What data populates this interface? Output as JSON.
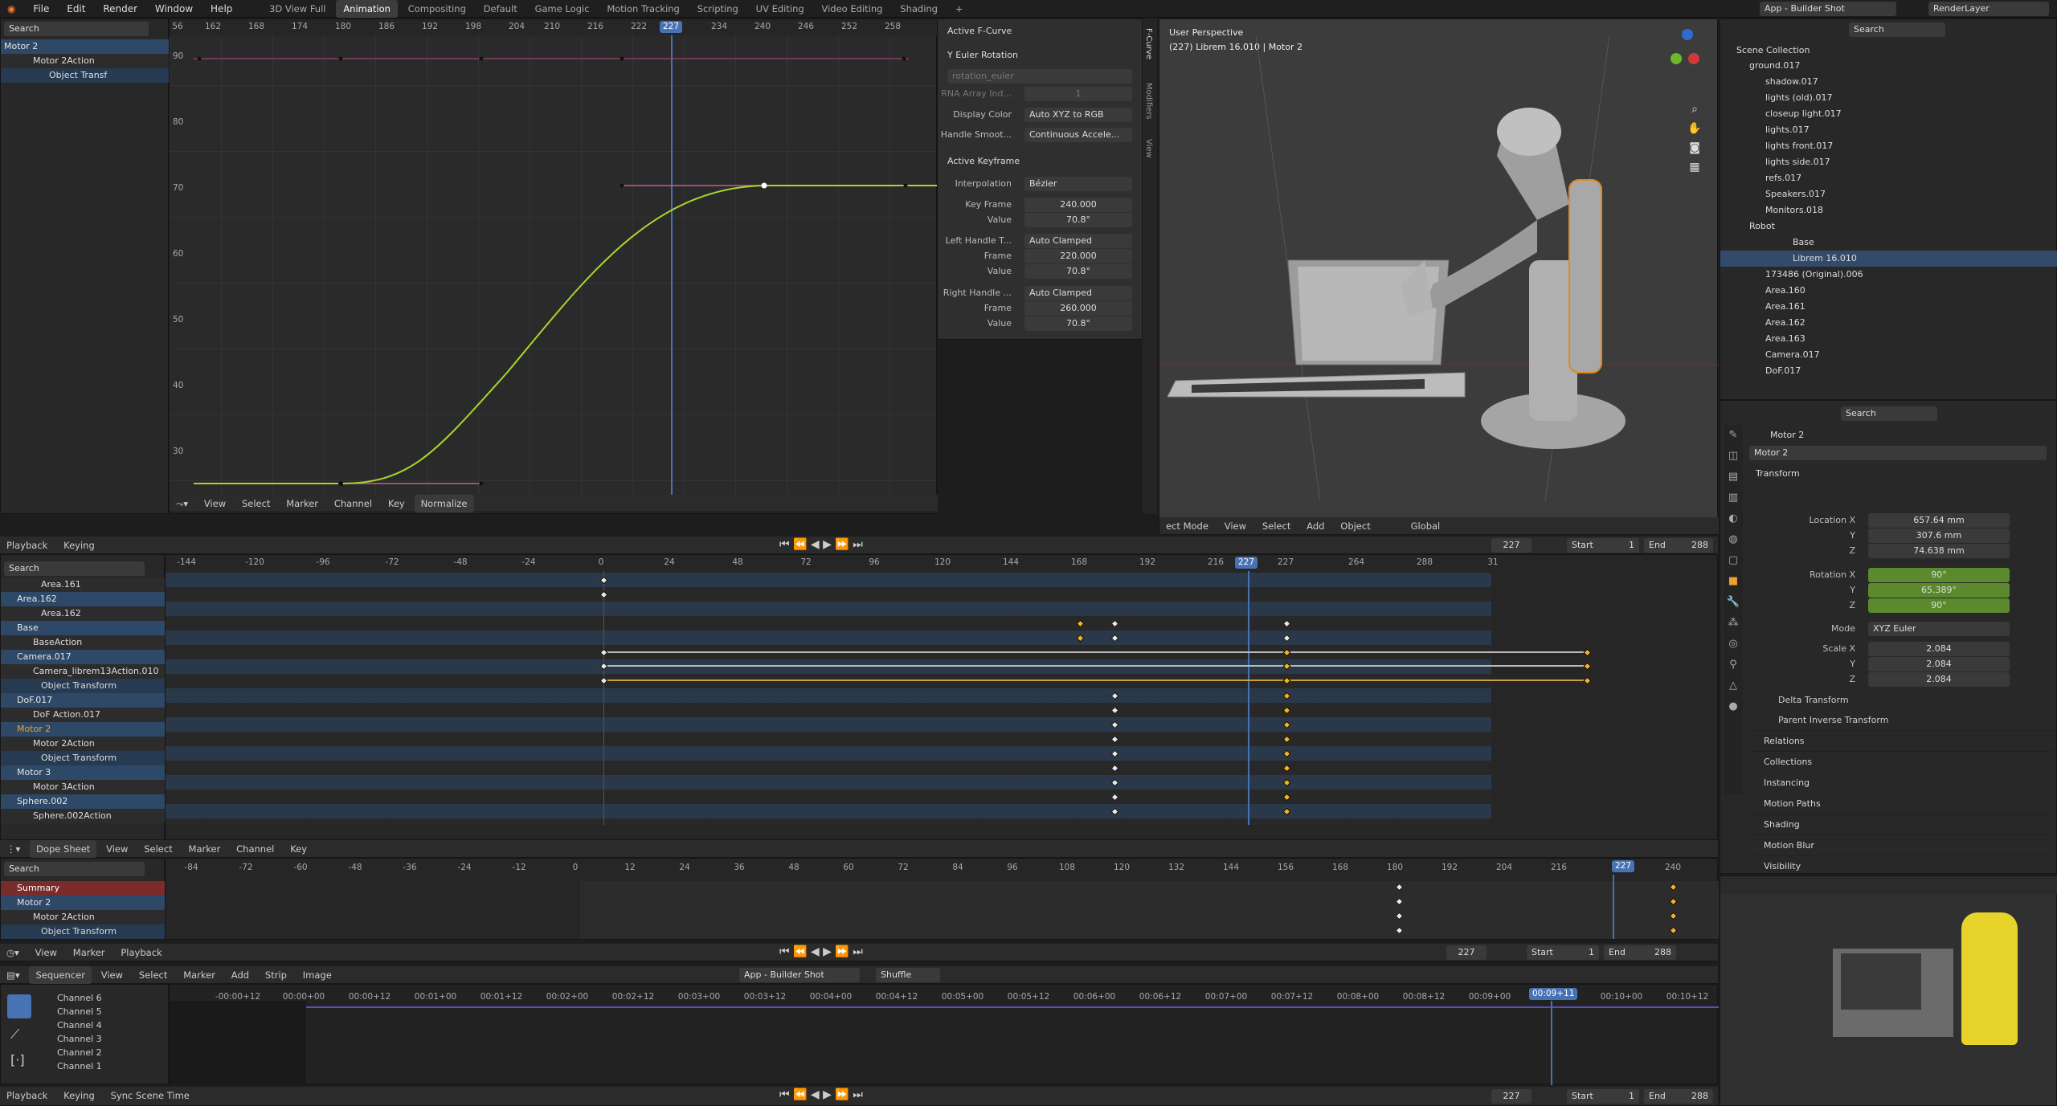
{
  "menu": {
    "items": [
      "File",
      "Edit",
      "Render",
      "Window",
      "Help"
    ],
    "workspaces": [
      "3D View Full",
      "Animation",
      "Compositing",
      "Default",
      "Game Logic",
      "Motion Tracking",
      "Scripting",
      "UV Editing",
      "Video Editing",
      "Shading"
    ],
    "scene": "App - Builder Shot",
    "render_layer": "RenderLayer"
  },
  "graph": {
    "search_placeholder": "Search",
    "channels": [
      "Motor 2",
      "Motor 2Action",
      "Object Transf"
    ],
    "ticks": [
      "56",
      "162",
      "168",
      "174",
      "180",
      "186",
      "192",
      "198",
      "204",
      "210",
      "216",
      "222",
      "227",
      "234",
      "240",
      "246",
      "252",
      "258",
      "264"
    ],
    "yticks": [
      "90",
      "80",
      "70",
      "60",
      "50",
      "40",
      "30"
    ],
    "current_frame": "227",
    "header": [
      "View",
      "Select",
      "Marker",
      "Channel",
      "Key",
      "Normalize"
    ]
  },
  "fcurve_panel": {
    "tabs": [
      "F-Curve",
      "Modifiers",
      "View"
    ],
    "active_fcurve_title": "Active F-Curve",
    "channel": "Y Euler Rotation",
    "data_path": "rotation_euler",
    "rna_label": "RNA Array Ind...",
    "rna_value": "1",
    "display_color_label": "Display Color",
    "display_color": "Auto XYZ to RGB",
    "handle_smooth_label": "Handle Smoot...",
    "handle_smooth": "Continuous Accele...",
    "active_keyframe_title": "Active Keyframe",
    "interp_label": "Interpolation",
    "interp": "Bézier",
    "kf_frame_label": "Key Frame",
    "kf_frame": "240.000",
    "value_label": "Value",
    "kf_value": "70.8°",
    "lh_label": "Left Handle T...",
    "lh_type": "Auto Clamped",
    "frame_label": "Frame",
    "lh_frame": "220.000",
    "lh_value": "70.8°",
    "rh_label": "Right Handle ...",
    "rh_type": "Auto Clamped",
    "rh_frame": "260.000",
    "rh_value": "70.8°"
  },
  "viewport": {
    "title": "User Perspective",
    "subtitle": "(227) Librem 16.010 | Motor 2",
    "mode": "ect Mode",
    "header": [
      "View",
      "Select",
      "Add",
      "Object",
      "Global"
    ]
  },
  "outliner": {
    "search_placeholder": "Search",
    "title": "Scene Collection",
    "rows": [
      "ground.017",
      "shadow.017",
      "lights (old).017",
      "closeup light.017",
      "lights.017",
      "lights front.017",
      "lights side.017",
      "refs.017",
      "Speakers.017",
      "Monitors.018",
      "Robot",
      "Base",
      "Librem 16.010",
      "173486 (Original).006",
      "Area.160",
      "Area.161",
      "Area.162",
      "Area.163",
      "Camera.017",
      "DoF.017"
    ]
  },
  "properties": {
    "search_placeholder": "Search",
    "object": "Motor 2",
    "object_field": "Motor 2",
    "transform": "Transform",
    "loc_label": "Location X",
    "loc": [
      "657.64 mm",
      "307.6 mm",
      "74.638 mm"
    ],
    "rot_label": "Rotation X",
    "rot": [
      "90°",
      "65.389°",
      "90°"
    ],
    "mode_label": "Mode",
    "mode": "XYZ Euler",
    "scale_label": "Scale X",
    "scale": [
      "2.084",
      "2.084",
      "2.084"
    ],
    "y": "Y",
    "z": "Z",
    "delta": "Delta Transform",
    "parent_inv": "Parent Inverse Transform",
    "sections": [
      "Relations",
      "Collections",
      "Instancing",
      "Motion Paths",
      "Shading",
      "Motion Blur",
      "Visibility"
    ]
  },
  "timeline1": {
    "playback": "Playback",
    "keying": "Keying",
    "frame": "227",
    "start_label": "Start",
    "start": "1",
    "end_label": "End",
    "end": "288",
    "search_placeholder": "Search",
    "ticks": [
      "-144",
      "-120",
      "-96",
      "-72",
      "-48",
      "-24",
      "0",
      "24",
      "48",
      "72",
      "96",
      "120",
      "144",
      "168",
      "192",
      "216",
      "227",
      "240",
      "264",
      "288",
      "31"
    ],
    "channels": [
      "Area.161",
      "Area.162",
      "Area.162",
      "Base",
      "BaseAction",
      "Camera.017",
      "Camera_librem13Action.010",
      "Object Transform",
      "DoF.017",
      "DoF Action.017",
      "Motor 2",
      "Motor 2Action",
      "Object Transform",
      "Motor 3",
      "Motor 3Action",
      "Sphere.002",
      "Sphere.002Action"
    ]
  },
  "dopesheet": {
    "mode": "Dope Sheet",
    "header": [
      "View",
      "Select",
      "Marker",
      "Channel",
      "Key"
    ],
    "search_placeholder": "Search",
    "ticks": [
      "-84",
      "-72",
      "-60",
      "-48",
      "-36",
      "-24",
      "-12",
      "0",
      "12",
      "24",
      "36",
      "48",
      "60",
      "72",
      "84",
      "96",
      "108",
      "120",
      "132",
      "144",
      "156",
      "168",
      "180",
      "192",
      "204",
      "216",
      "227",
      "240"
    ],
    "channels": [
      "Summary",
      "Motor 2",
      "Motor 2Action",
      "Object Transform"
    ]
  },
  "timeline2": {
    "header": [
      "View",
      "Marker",
      "Playback"
    ],
    "frame": "227",
    "start_label": "Start",
    "start": "1",
    "end_label": "End",
    "end": "288"
  },
  "sequencer": {
    "mode": "Sequencer",
    "header": [
      "View",
      "Select",
      "Marker",
      "Add",
      "Strip",
      "Image"
    ],
    "scene": "App - Builder Shot",
    "shuffle": "Shuffle",
    "ticks": [
      "-00:00+12",
      "00:00+00",
      "00:00+12",
      "00:01+00",
      "00:01+12",
      "00:02+00",
      "00:02+12",
      "00:03+00",
      "00:03+12",
      "00:04+00",
      "00:04+12",
      "00:05+00",
      "00:05+12",
      "00:06+00",
      "00:06+12",
      "00:07+00",
      "00:07+12",
      "00:08+00",
      "00:08+12",
      "00:09+00",
      "00:09+11",
      "00:10+00",
      "00:10+12"
    ],
    "channels": [
      "Channel 6",
      "Channel 5",
      "Channel 4",
      "Channel 3",
      "Channel 2",
      "Channel 1"
    ]
  },
  "bottombar": {
    "playback": "Playback",
    "keying": "Keying",
    "sync": "Sync Scene Time",
    "frame": "227",
    "start_label": "Start",
    "start": "1",
    "end_label": "End",
    "end": "288"
  },
  "colors": {
    "accent": "#4772b3",
    "curve": "#a8d62a",
    "key_selected": "#f0b429"
  }
}
